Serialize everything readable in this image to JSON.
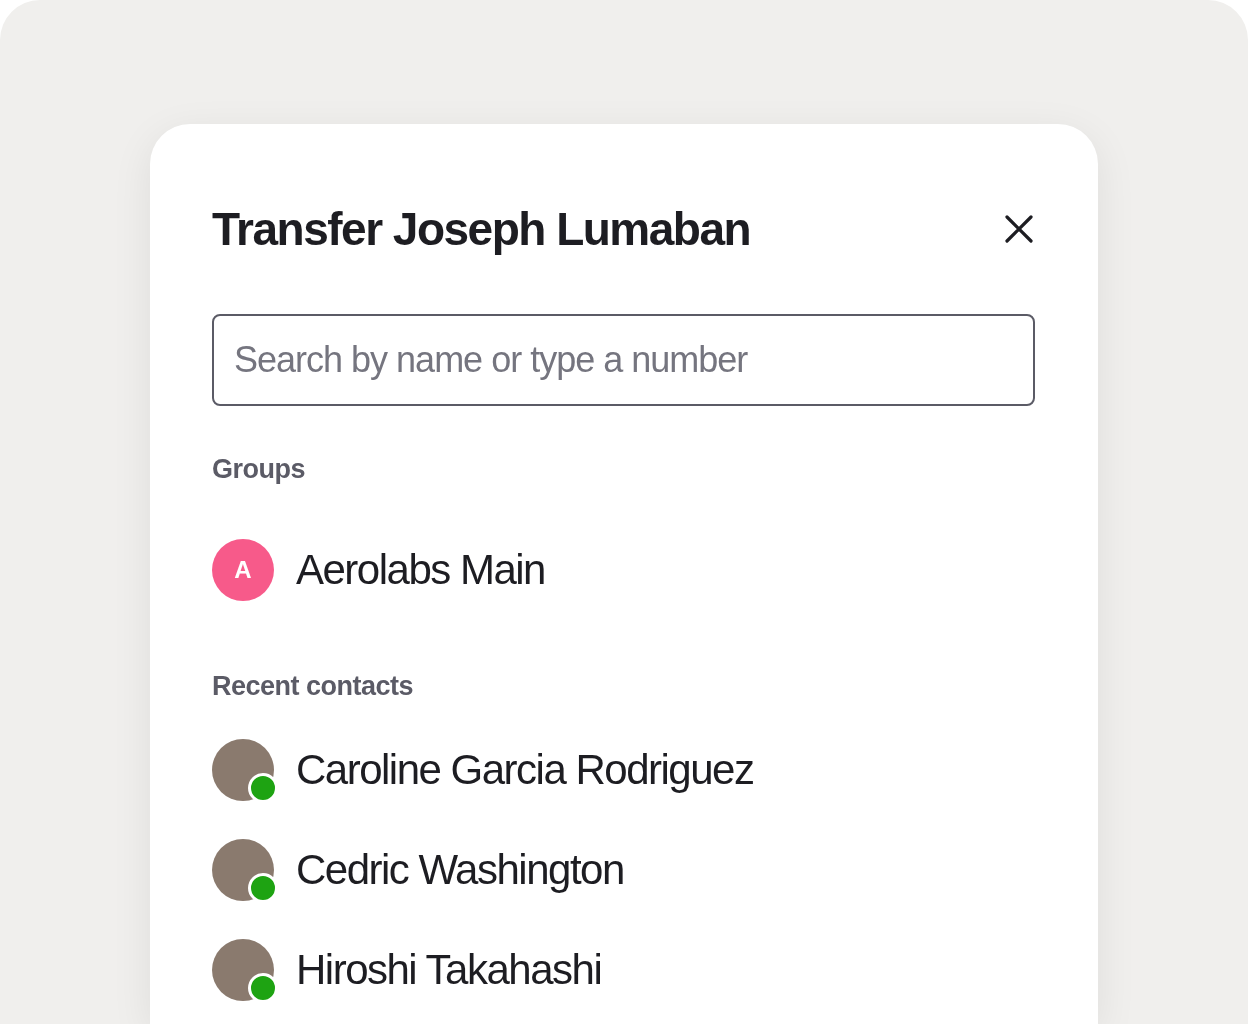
{
  "dialog": {
    "title": "Transfer Joseph Lumaban",
    "search": {
      "placeholder": "Search by name or type a number"
    },
    "groups": {
      "heading": "Groups",
      "items": [
        {
          "initial": "A",
          "name": "Aerolabs Main"
        }
      ]
    },
    "recent_contacts": {
      "heading": "Recent contacts",
      "items": [
        {
          "name": "Caroline Garcia Rodriguez",
          "online": true
        },
        {
          "name": "Cedric Washington",
          "online": true
        },
        {
          "name": "Hiroshi Takahashi",
          "online": true
        }
      ]
    }
  }
}
